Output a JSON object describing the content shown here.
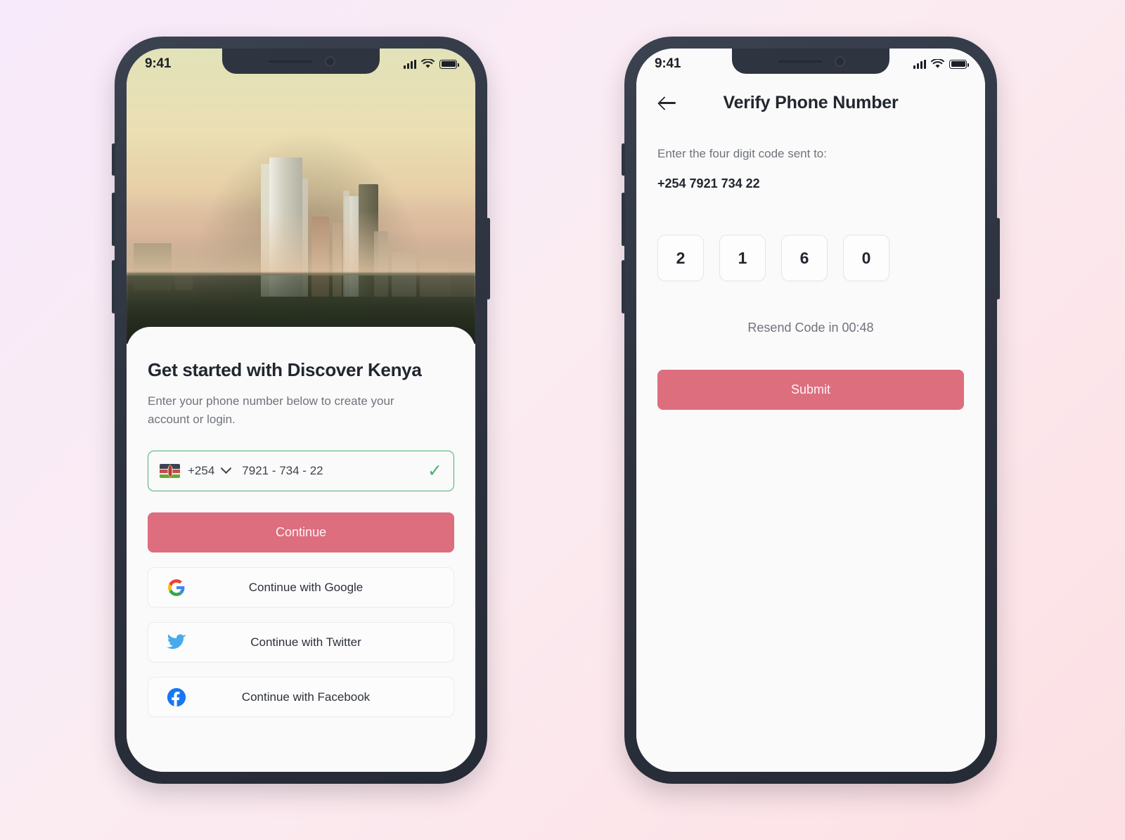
{
  "theme": {
    "accent": "#DD6E7E",
    "frame": "#2E3440",
    "screen_bg": "#FAFAFA",
    "success_green": "#4CAF72",
    "text_dark": "#22262E",
    "text_muted": "#6F737C",
    "page_bg_from": "#F7EAFA",
    "page_bg_to": "#FCE0E3"
  },
  "status_bar": {
    "time": "9:41",
    "cellular_icon": "signal-bars-icon",
    "wifi_icon": "wifi-icon",
    "battery_icon": "battery-icon"
  },
  "signup_screen": {
    "hero_image_alt": "nairobi-skyline-photo",
    "title": "Get started with Discover Kenya",
    "subtitle": "Enter your phone number below to create your account or login.",
    "phone_field": {
      "flag_icon": "kenya-flag-icon",
      "country_code": "+254",
      "dropdown_icon": "chevron-down-icon",
      "value": "7921 - 734 - 22",
      "placeholder": "7921 - 734 - 22",
      "valid_icon": "check-icon"
    },
    "primary_button": "Continue",
    "social_buttons": [
      {
        "icon": "google-icon",
        "label": "Continue with Google"
      },
      {
        "icon": "twitter-icon",
        "label": "Continue with Twitter"
      },
      {
        "icon": "facebook-icon",
        "label": "Continue with Facebook"
      }
    ]
  },
  "verify_screen": {
    "back_icon": "arrow-left-icon",
    "title": "Verify Phone Number",
    "instruction": "Enter the four digit code sent to:",
    "phone_number": "+254 7921 734 22",
    "otp_digits": [
      "2",
      "1",
      "6",
      "0"
    ],
    "resend_text": "Resend Code in 00:48",
    "submit_button": "Submit"
  }
}
